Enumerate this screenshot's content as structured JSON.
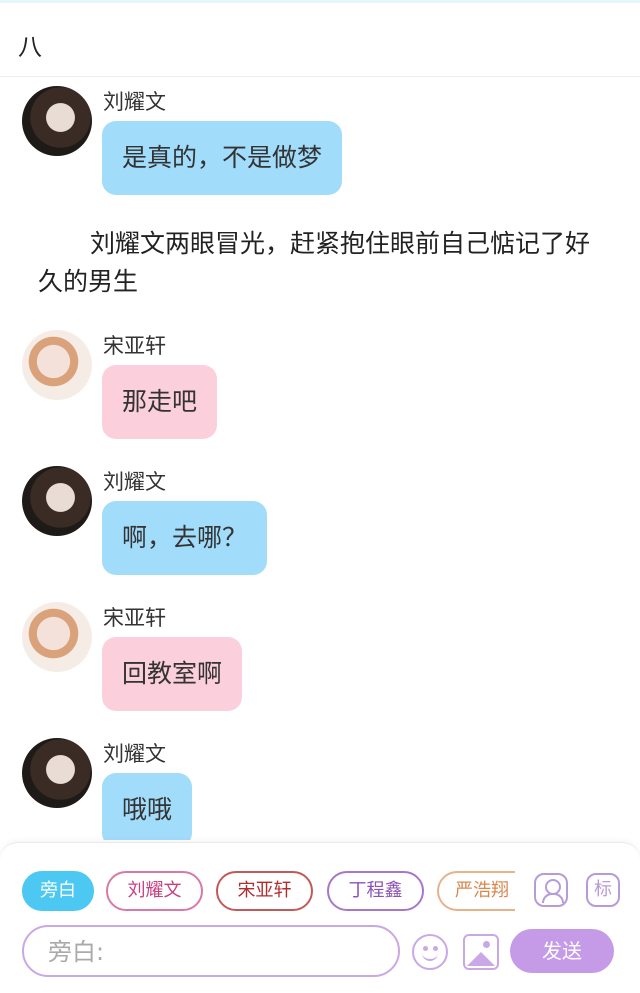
{
  "chapter": {
    "title": "八"
  },
  "messages": [
    {
      "type": "chat",
      "sender": "刘耀文",
      "text": "是真的，不是做梦",
      "color": "#a2dcfb"
    },
    {
      "type": "narration",
      "text": "刘耀文两眼冒光，赶紧抱住眼前自己惦记了好久的男生"
    },
    {
      "type": "chat",
      "sender": "宋亚轩",
      "text": "那走吧",
      "color": "#fbcfdc"
    },
    {
      "type": "chat",
      "sender": "刘耀文",
      "text": "啊，去哪？",
      "color": "#a2dcfb"
    },
    {
      "type": "chat",
      "sender": "宋亚轩",
      "text": "回教室啊",
      "color": "#fbcfdc"
    },
    {
      "type": "chat",
      "sender": "刘耀文",
      "text": "哦哦",
      "color": "#a2dcfb"
    }
  ],
  "composer": {
    "roles": [
      {
        "label": "旁白",
        "selected": true
      },
      {
        "label": "刘耀文"
      },
      {
        "label": "宋亚轩"
      },
      {
        "label": "丁程鑫"
      },
      {
        "label": "严浩翔"
      }
    ],
    "mark_label": "标",
    "input_placeholder": "旁白:",
    "send_label": "发送",
    "icons": [
      "person-icon",
      "mark-icon",
      "emoji-icon",
      "image-icon"
    ],
    "accent": "#c59be8",
    "narrator_color": "#4cc8f2"
  }
}
